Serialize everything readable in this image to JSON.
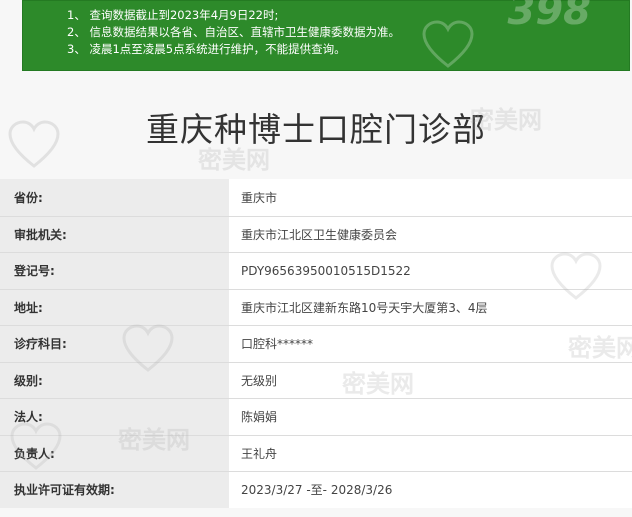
{
  "notice": {
    "line1": "1、 查询数据截止到2023年4月9日22时;",
    "line2": "2、 信息数据结果以各省、自治区、直辖市卫生健康委数据为准。",
    "line3": "3、 凌晨1点至凌晨5点系统进行维护，不能提供查询。"
  },
  "page_title": "重庆种博士口腔门诊部",
  "rows": [
    {
      "label": "省份:",
      "value": "重庆市"
    },
    {
      "label": "审批机关:",
      "value": "重庆市江北区卫生健康委员会"
    },
    {
      "label": "登记号:",
      "value": "PDY96563950010515D1522"
    },
    {
      "label": "地址:",
      "value": "重庆市江北区建新东路10号天宇大厦第3、4层"
    },
    {
      "label": "诊疗科目:",
      "value": "口腔科******"
    },
    {
      "label": "级别:",
      "value": "无级别"
    },
    {
      "label": "法人:",
      "value": "陈娟娟"
    },
    {
      "label": "负责人:",
      "value": "王礼舟"
    },
    {
      "label": "执业许可证有效期:",
      "value": "2023/3/27 -至- 2028/3/26"
    }
  ],
  "watermark": {
    "text": "密美网",
    "brand": "398"
  }
}
